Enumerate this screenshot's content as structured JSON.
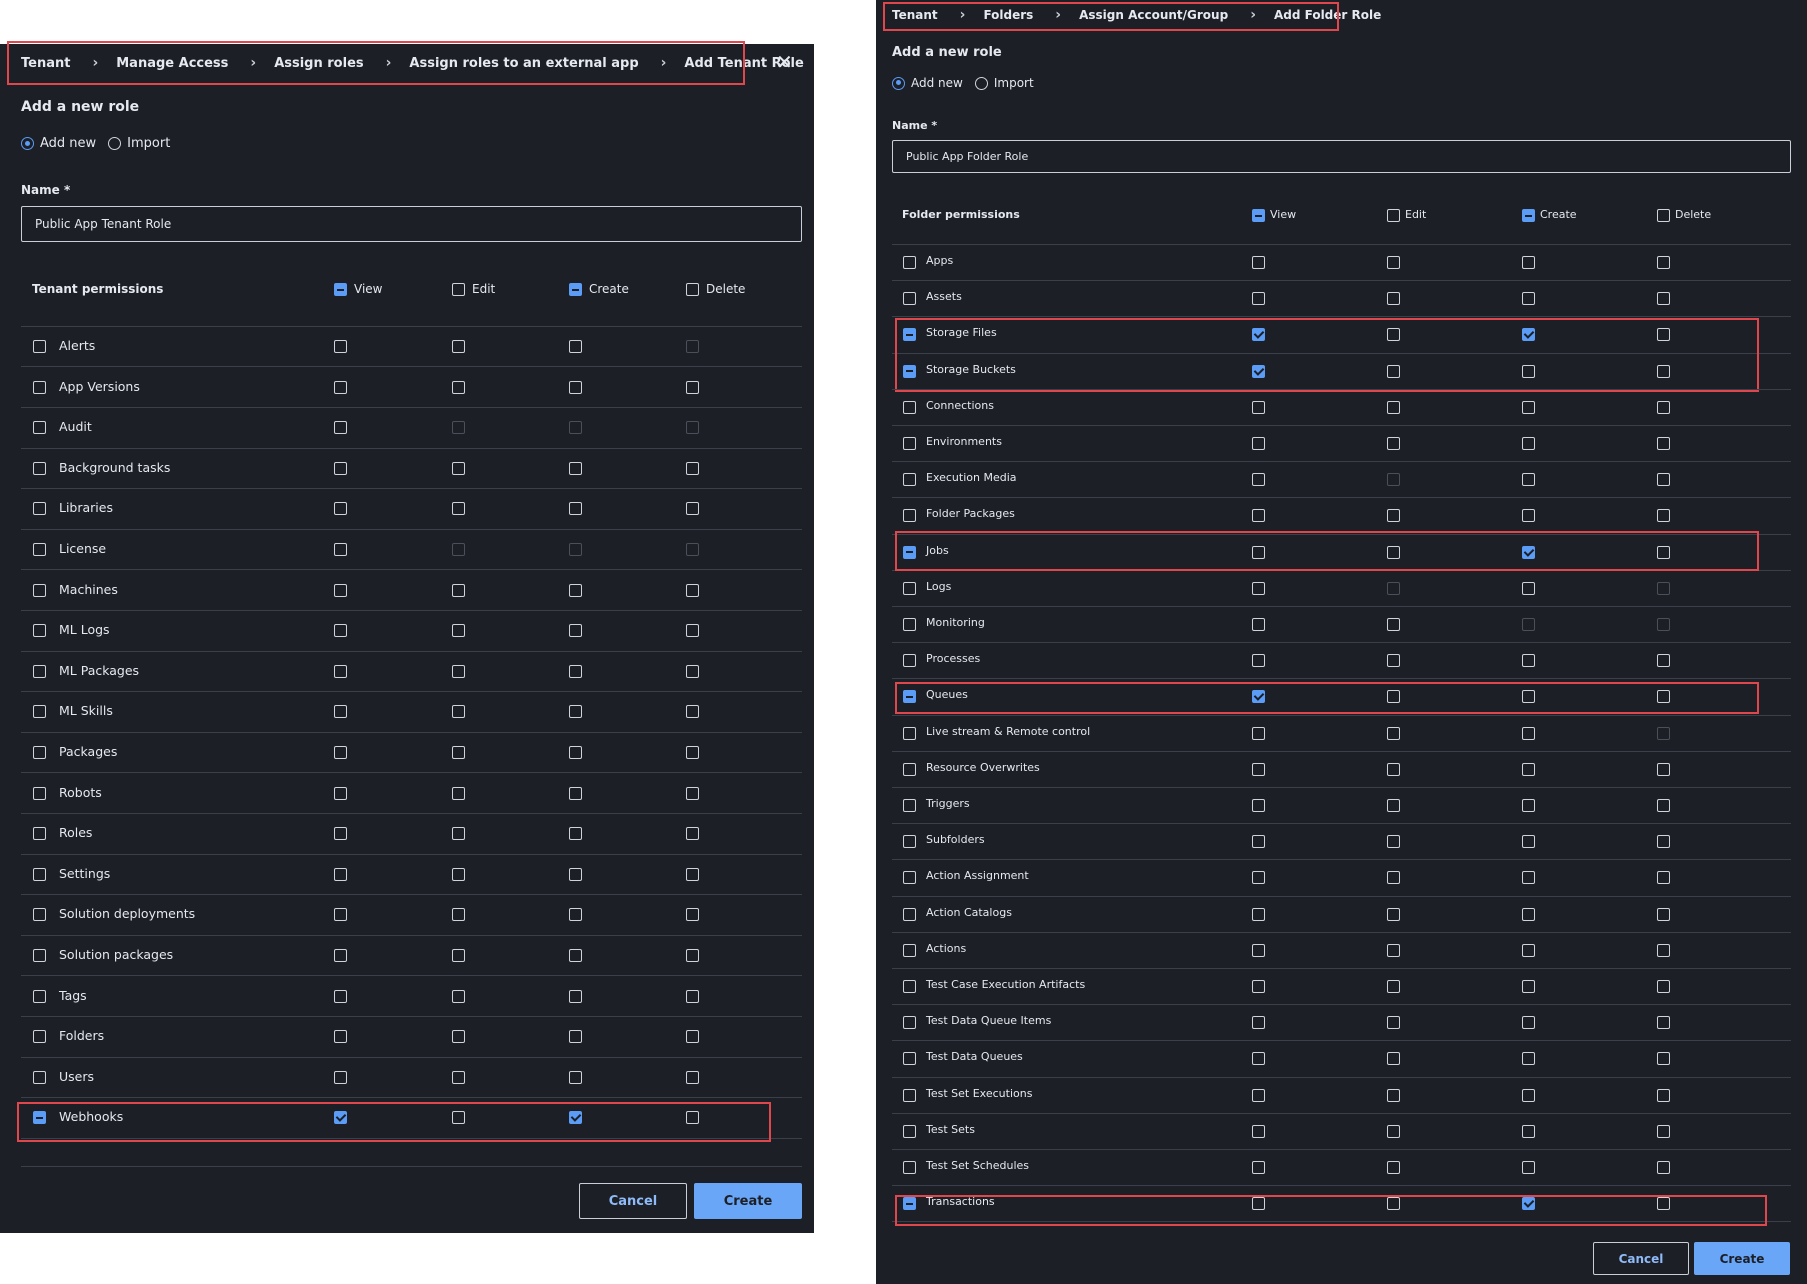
{
  "tenant_dialog": {
    "breadcrumb": [
      "Tenant",
      "Manage Access",
      "Assign roles",
      "Assign roles to an external app",
      "Add Tenant Role"
    ],
    "close_icon": "close-icon",
    "heading": "Add a new role",
    "radio_add_new": "Add new",
    "radio_import": "Import",
    "name_label": "Name *",
    "name_value": "Public App Tenant Role",
    "permissions_header": "Tenant permissions",
    "columns": [
      "View",
      "Edit",
      "Create",
      "Delete"
    ],
    "column_states": [
      "indeterminate",
      "unchecked",
      "indeterminate",
      "unchecked"
    ],
    "rows": [
      {
        "label": "Alerts",
        "row_state": "unchecked",
        "cells": [
          "unchecked",
          "unchecked",
          "unchecked",
          "disabled"
        ]
      },
      {
        "label": "App Versions",
        "row_state": "unchecked",
        "cells": [
          "unchecked",
          "unchecked",
          "unchecked",
          "unchecked"
        ]
      },
      {
        "label": "Audit",
        "row_state": "unchecked",
        "cells": [
          "unchecked",
          "disabled",
          "disabled",
          "disabled"
        ]
      },
      {
        "label": "Background tasks",
        "row_state": "unchecked",
        "cells": [
          "unchecked",
          "unchecked",
          "unchecked",
          "unchecked"
        ]
      },
      {
        "label": "Libraries",
        "row_state": "unchecked",
        "cells": [
          "unchecked",
          "unchecked",
          "unchecked",
          "unchecked"
        ]
      },
      {
        "label": "License",
        "row_state": "unchecked",
        "cells": [
          "unchecked",
          "disabled",
          "disabled",
          "disabled"
        ]
      },
      {
        "label": "Machines",
        "row_state": "unchecked",
        "cells": [
          "unchecked",
          "unchecked",
          "unchecked",
          "unchecked"
        ]
      },
      {
        "label": "ML Logs",
        "row_state": "unchecked",
        "cells": [
          "unchecked",
          "unchecked",
          "unchecked",
          "unchecked"
        ]
      },
      {
        "label": "ML Packages",
        "row_state": "unchecked",
        "cells": [
          "unchecked",
          "unchecked",
          "unchecked",
          "unchecked"
        ]
      },
      {
        "label": "ML Skills",
        "row_state": "unchecked",
        "cells": [
          "unchecked",
          "unchecked",
          "unchecked",
          "unchecked"
        ]
      },
      {
        "label": "Packages",
        "row_state": "unchecked",
        "cells": [
          "unchecked",
          "unchecked",
          "unchecked",
          "unchecked"
        ]
      },
      {
        "label": "Robots",
        "row_state": "unchecked",
        "cells": [
          "unchecked",
          "unchecked",
          "unchecked",
          "unchecked"
        ]
      },
      {
        "label": "Roles",
        "row_state": "unchecked",
        "cells": [
          "unchecked",
          "unchecked",
          "unchecked",
          "unchecked"
        ]
      },
      {
        "label": "Settings",
        "row_state": "unchecked",
        "cells": [
          "unchecked",
          "unchecked",
          "unchecked",
          "unchecked"
        ]
      },
      {
        "label": "Solution deployments",
        "row_state": "unchecked",
        "cells": [
          "unchecked",
          "unchecked",
          "unchecked",
          "unchecked"
        ]
      },
      {
        "label": "Solution packages",
        "row_state": "unchecked",
        "cells": [
          "unchecked",
          "unchecked",
          "unchecked",
          "unchecked"
        ]
      },
      {
        "label": "Tags",
        "row_state": "unchecked",
        "cells": [
          "unchecked",
          "unchecked",
          "unchecked",
          "unchecked"
        ]
      },
      {
        "label": "Folders",
        "row_state": "unchecked",
        "cells": [
          "unchecked",
          "unchecked",
          "unchecked",
          "unchecked"
        ]
      },
      {
        "label": "Users",
        "row_state": "unchecked",
        "cells": [
          "unchecked",
          "unchecked",
          "unchecked",
          "unchecked"
        ]
      },
      {
        "label": "Webhooks",
        "row_state": "indeterminate",
        "cells": [
          "checked",
          "unchecked",
          "checked",
          "unchecked"
        ],
        "highlight": true
      }
    ],
    "cancel_label": "Cancel",
    "create_label": "Create"
  },
  "folder_dialog": {
    "breadcrumb": [
      "Tenant",
      "Folders",
      "Assign Account/Group",
      "Add Folder Role"
    ],
    "heading": "Add a new role",
    "radio_add_new": "Add new",
    "radio_import": "Import",
    "name_label": "Name *",
    "name_value": "Public App Folder Role",
    "permissions_header": "Folder permissions",
    "columns": [
      "View",
      "Edit",
      "Create",
      "Delete"
    ],
    "column_states": [
      "indeterminate",
      "unchecked",
      "indeterminate",
      "unchecked"
    ],
    "rows": [
      {
        "label": "Apps",
        "row_state": "unchecked",
        "cells": [
          "unchecked",
          "unchecked",
          "unchecked",
          "unchecked"
        ]
      },
      {
        "label": "Assets",
        "row_state": "unchecked",
        "cells": [
          "unchecked",
          "unchecked",
          "unchecked",
          "unchecked"
        ]
      },
      {
        "label": "Storage Files",
        "row_state": "indeterminate",
        "cells": [
          "checked",
          "unchecked",
          "checked",
          "unchecked"
        ]
      },
      {
        "label": "Storage Buckets",
        "row_state": "indeterminate",
        "cells": [
          "checked",
          "unchecked",
          "unchecked",
          "unchecked"
        ]
      },
      {
        "label": "Connections",
        "row_state": "unchecked",
        "cells": [
          "unchecked",
          "unchecked",
          "unchecked",
          "unchecked"
        ]
      },
      {
        "label": "Environments",
        "row_state": "unchecked",
        "cells": [
          "unchecked",
          "unchecked",
          "unchecked",
          "unchecked"
        ]
      },
      {
        "label": "Execution Media",
        "row_state": "unchecked",
        "cells": [
          "unchecked",
          "disabled",
          "unchecked",
          "unchecked"
        ]
      },
      {
        "label": "Folder Packages",
        "row_state": "unchecked",
        "cells": [
          "unchecked",
          "unchecked",
          "unchecked",
          "unchecked"
        ]
      },
      {
        "label": "Jobs",
        "row_state": "indeterminate",
        "cells": [
          "unchecked",
          "unchecked",
          "checked",
          "unchecked"
        ]
      },
      {
        "label": "Logs",
        "row_state": "unchecked",
        "cells": [
          "unchecked",
          "disabled",
          "unchecked",
          "disabled"
        ]
      },
      {
        "label": "Monitoring",
        "row_state": "unchecked",
        "cells": [
          "unchecked",
          "unchecked",
          "disabled",
          "disabled"
        ]
      },
      {
        "label": "Processes",
        "row_state": "unchecked",
        "cells": [
          "unchecked",
          "unchecked",
          "unchecked",
          "unchecked"
        ]
      },
      {
        "label": "Queues",
        "row_state": "indeterminate",
        "cells": [
          "checked",
          "unchecked",
          "unchecked",
          "unchecked"
        ]
      },
      {
        "label": "Live stream & Remote control",
        "row_state": "unchecked",
        "cells": [
          "unchecked",
          "unchecked",
          "unchecked",
          "disabled"
        ]
      },
      {
        "label": "Resource Overwrites",
        "row_state": "unchecked",
        "cells": [
          "unchecked",
          "unchecked",
          "unchecked",
          "unchecked"
        ]
      },
      {
        "label": "Triggers",
        "row_state": "unchecked",
        "cells": [
          "unchecked",
          "unchecked",
          "unchecked",
          "unchecked"
        ]
      },
      {
        "label": "Subfolders",
        "row_state": "unchecked",
        "cells": [
          "unchecked",
          "unchecked",
          "unchecked",
          "unchecked"
        ]
      },
      {
        "label": "Action Assignment",
        "row_state": "unchecked",
        "cells": [
          "unchecked",
          "unchecked",
          "unchecked",
          "unchecked"
        ]
      },
      {
        "label": "Action Catalogs",
        "row_state": "unchecked",
        "cells": [
          "unchecked",
          "unchecked",
          "unchecked",
          "unchecked"
        ]
      },
      {
        "label": "Actions",
        "row_state": "unchecked",
        "cells": [
          "unchecked",
          "unchecked",
          "unchecked",
          "unchecked"
        ]
      },
      {
        "label": "Test Case Execution Artifacts",
        "row_state": "unchecked",
        "cells": [
          "unchecked",
          "unchecked",
          "unchecked",
          "unchecked"
        ]
      },
      {
        "label": "Test Data Queue Items",
        "row_state": "unchecked",
        "cells": [
          "unchecked",
          "unchecked",
          "unchecked",
          "unchecked"
        ]
      },
      {
        "label": "Test Data Queues",
        "row_state": "unchecked",
        "cells": [
          "unchecked",
          "unchecked",
          "unchecked",
          "unchecked"
        ]
      },
      {
        "label": "Test Set Executions",
        "row_state": "unchecked",
        "cells": [
          "unchecked",
          "unchecked",
          "unchecked",
          "unchecked"
        ]
      },
      {
        "label": "Test Sets",
        "row_state": "unchecked",
        "cells": [
          "unchecked",
          "unchecked",
          "unchecked",
          "unchecked"
        ]
      },
      {
        "label": "Test Set Schedules",
        "row_state": "unchecked",
        "cells": [
          "unchecked",
          "unchecked",
          "unchecked",
          "unchecked"
        ]
      },
      {
        "label": "Transactions",
        "row_state": "indeterminate",
        "cells": [
          "unchecked",
          "unchecked",
          "checked",
          "unchecked"
        ]
      }
    ],
    "cancel_label": "Cancel",
    "create_label": "Create"
  },
  "colors": {
    "panel_bg": "#1c1f26",
    "accent": "#5b9cf6",
    "highlight_border": "#e0474c",
    "divider": "#3a3f4a"
  }
}
